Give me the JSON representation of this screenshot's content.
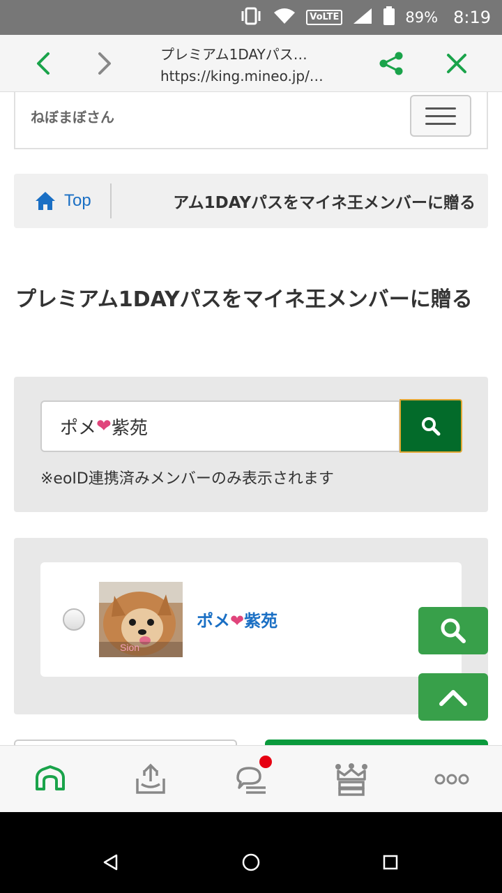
{
  "status_bar": {
    "battery_pct": "89%",
    "time": "8:19",
    "network_label": "VoLTE",
    "icons": [
      "vibrate-icon",
      "wifi-icon",
      "volte-icon",
      "signal-icon",
      "battery-icon"
    ]
  },
  "browser": {
    "title": "プレミアム1DAYパス…",
    "url": "https://king.mineo.jp/…",
    "accent_color": "#1aa34a"
  },
  "site": {
    "user_name": "ねぼまぼさん"
  },
  "breadcrumb": {
    "home_label": "Top",
    "current": "アム1DAYパスをマイネ王メンバーに贈る"
  },
  "page": {
    "title": "プレミアム1DAYパスをマイネ王メンバーに贈る"
  },
  "search": {
    "value_prefix": "ポメ",
    "value_heart": "❤",
    "value_suffix": "紫苑",
    "note": "※eoID連携済みメンバーのみ表示されます"
  },
  "result": {
    "member_prefix": "ポメ",
    "member_heart": "❤",
    "member_suffix": "紫苑",
    "avatar_caption": "Sion"
  },
  "colors": {
    "search_button": "#036b2a",
    "fab": "#38a04a",
    "link": "#1a6fc4",
    "heart": "#e0457b",
    "badge": "#e60012"
  }
}
